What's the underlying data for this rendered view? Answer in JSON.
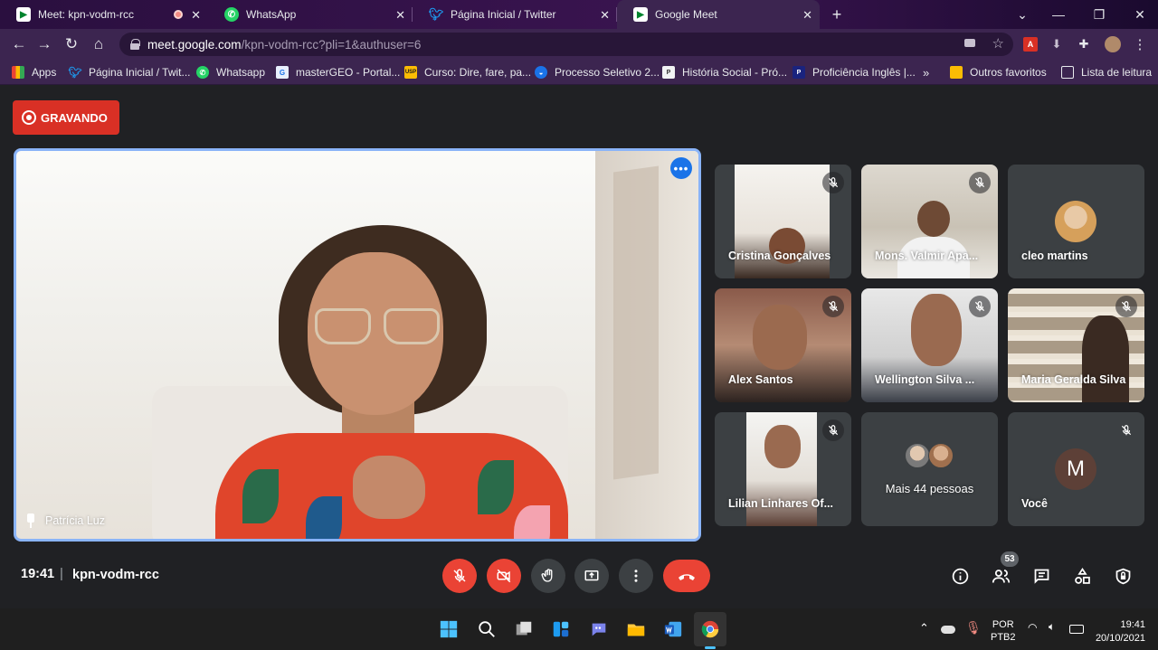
{
  "browser": {
    "tabs": [
      {
        "title": "Meet: kpn-vodm-rcc",
        "active": false
      },
      {
        "title": "WhatsApp",
        "active": false
      },
      {
        "title": "Página Inicial / Twitter",
        "active": false
      },
      {
        "title": "Google Meet",
        "active": true
      }
    ],
    "new_tab": "+",
    "url_host": "meet.google.com",
    "url_rest": "/kpn-vodm-rcc?pli=1&authuser=6",
    "bookmarks": [
      {
        "label": "Apps",
        "icon": "apps-grid-icon"
      },
      {
        "label": "Página Inicial / Twit...",
        "icon": "twitter-icon"
      },
      {
        "label": "Whatsapp",
        "icon": "whatsapp-icon"
      },
      {
        "label": "masterGEO - Portal...",
        "icon": "site-icon"
      },
      {
        "label": "Curso: Dire, fare, pa...",
        "icon": "usp-icon"
      },
      {
        "label": "Processo Seletivo 2...",
        "icon": "globe-icon"
      },
      {
        "label": "História Social - Pró...",
        "icon": "site-icon"
      },
      {
        "label": "Proficiência Inglês |...",
        "icon": "site-icon"
      }
    ],
    "bookmarks_overflow": "»",
    "other_bookmarks": "Outros favoritos",
    "reading_list": "Lista de leitura"
  },
  "meet": {
    "recording_label": "GRAVANDO",
    "presenter": {
      "name": "Patrícia Luz"
    },
    "participants": [
      {
        "name": "Cristina Gonçalves",
        "muted": true
      },
      {
        "name": "Mons. Valmir Apa...",
        "muted": true
      },
      {
        "name": "cleo martins",
        "muted": false
      },
      {
        "name": "Alex Santos",
        "muted": true
      },
      {
        "name": "Wellington Silva ...",
        "muted": true
      },
      {
        "name": "Maria Geralda Silva",
        "muted": true
      },
      {
        "name": "Lilian Linhares Of...",
        "muted": true
      },
      {
        "name": "Mais 44 pessoas",
        "muted": false
      },
      {
        "name": "Você",
        "muted": true,
        "avatar_letter": "M"
      }
    ],
    "time": "19:41",
    "meeting_code": "kpn-vodm-rcc",
    "separator": "|",
    "people_count": "53",
    "colors": {
      "accent_red": "#ea4335",
      "tile_bg": "#3c4043",
      "active_border": "#8ab4f8"
    }
  },
  "taskbar": {
    "lang_top": "POR",
    "lang_bottom": "PTB2",
    "clock_time": "19:41",
    "clock_date": "20/10/2021"
  }
}
